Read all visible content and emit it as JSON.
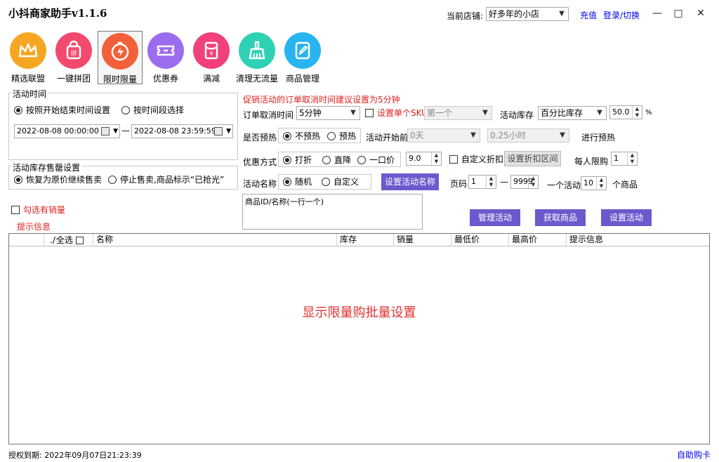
{
  "window": {
    "title": "小抖商家助手v1.1.6",
    "minimize": "—",
    "maximize": "□",
    "close": "✕"
  },
  "header": {
    "store_label": "当前店铺:",
    "store_value": "好多年的小店",
    "recharge": "充值",
    "login": "登录/切换"
  },
  "nav": [
    {
      "label": "精选联盟",
      "icon": "crown-icon",
      "color": "#f5a623"
    },
    {
      "label": "一键拼团",
      "icon": "shopping-bag-icon",
      "color": "#f24a6e"
    },
    {
      "label": "限时限量",
      "icon": "timer-lightning-icon",
      "color": "#f2603a",
      "active": true
    },
    {
      "label": "优惠券",
      "icon": "coupon-icon",
      "color": "#9b6cf0"
    },
    {
      "label": "满减",
      "icon": "red-envelope-icon",
      "color": "#f2407a"
    },
    {
      "label": "清理无流量",
      "icon": "broom-icon",
      "color": "#2ed1b3"
    },
    {
      "label": "商品管理",
      "icon": "edit-icon",
      "color": "#28b4f0"
    }
  ],
  "time_group": {
    "title": "活动时间",
    "radio_1": "按照开始结束时间设置",
    "radio_2": "按时间段选择",
    "start": "2022-08-08 00:00:00",
    "dash": "—",
    "end": "2022-08-08 23:59:59"
  },
  "stock_group": {
    "title": "活动库存售罄设置",
    "radio_1": "恢复为原价继续售卖",
    "radio_2": "停止售卖,商品标示“已抢光”"
  },
  "left": {
    "sales_check": "勾选有销量",
    "hint": "提示信息"
  },
  "form": {
    "warning": "促销活动的订单取消时间建议设置为5分钟",
    "cancel_label": "订单取消时间",
    "cancel_value": "5分钟",
    "sku_check": "设置单个SKU",
    "sku_value": "第一个",
    "stock_label": "活动库存",
    "stock_value": "百分比库存",
    "stock_pct": "50.0",
    "pct_sign": "%",
    "preheat_label": "是否预热",
    "preheat_no": "不预热",
    "preheat_yes": "预热",
    "before_label": "活动开始前",
    "before_value": "0天",
    "hours_value": "0.25小时",
    "preheat_tail": "进行预热",
    "discount_label": "优惠方式",
    "discount_1": "打折",
    "discount_2": "直降",
    "discount_3": "一口价",
    "discount_value": "9.0",
    "custom_discount": "自定义折扣",
    "discount_range_btn": "设置折扣区间",
    "limit_label": "每人限购",
    "limit_value": "1",
    "name_label": "活动名称",
    "name_random": "随机",
    "name_custom": "自定义",
    "set_name_btn": "设置活动名称",
    "page_label": "页码",
    "page_from": "1",
    "page_dash": "—",
    "page_to": "9999",
    "per_label": "一个活动",
    "per_value": "10",
    "per_unit": "个商品",
    "textarea": "商品ID/名称(一行一个)",
    "manage_btn": "管理活动",
    "fetch_btn": "获取商品",
    "set_btn": "设置活动"
  },
  "grid": {
    "select_all": "全选",
    "columns": [
      "名称",
      "库存",
      "销量",
      "最低价",
      "最高价",
      "提示信息"
    ],
    "message": "显示限量购批量设置"
  },
  "footer": {
    "license": "授权到期: 2022年09月07日21:23:39",
    "buy_card": "自助购卡"
  }
}
